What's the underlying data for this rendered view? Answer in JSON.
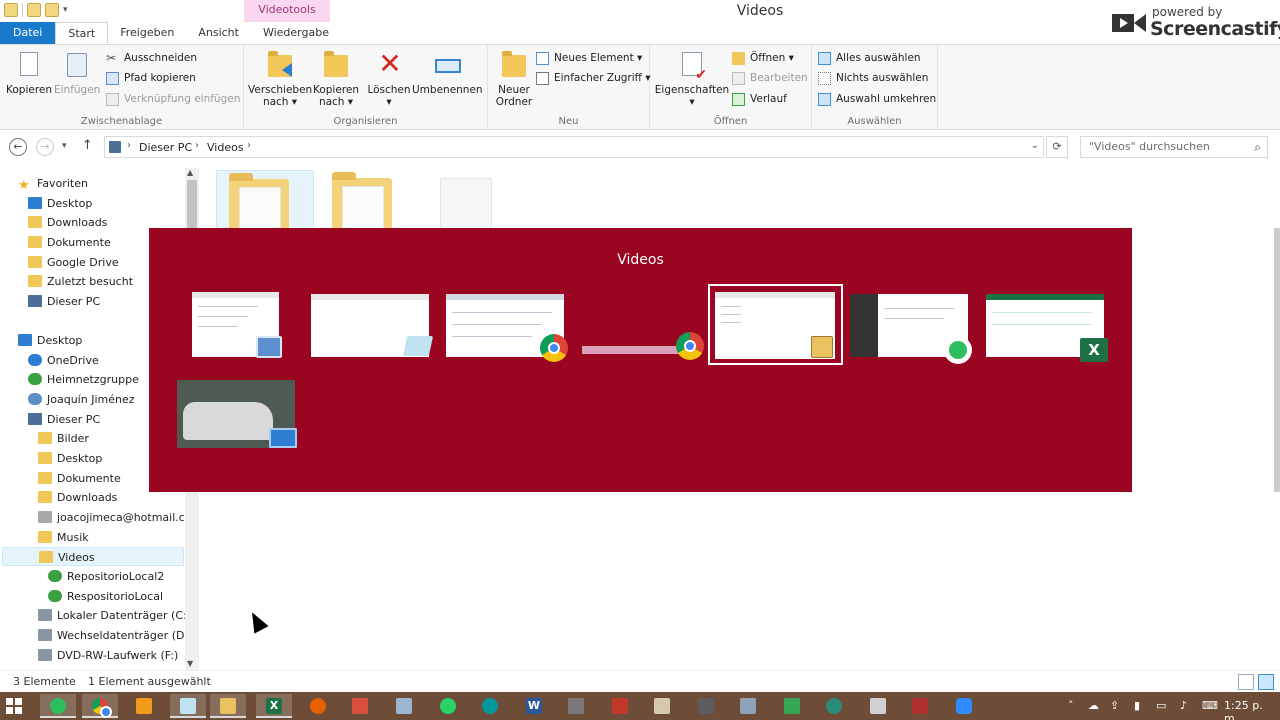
{
  "titlebar": {
    "title": "Videos",
    "context_tab": "Videotools"
  },
  "watermark": {
    "small": "powered by",
    "big": "Screencastify"
  },
  "tabs": [
    {
      "label": "Datei"
    },
    {
      "label": "Start"
    },
    {
      "label": "Freigeben"
    },
    {
      "label": "Ansicht"
    },
    {
      "label": "Wiedergabe"
    }
  ],
  "ribbon": {
    "groups": {
      "clipboard": "Zwischenablage",
      "organize": "Organisieren",
      "new": "Neu",
      "open": "Öffnen",
      "select": "Auswählen"
    },
    "copy": "Kopieren",
    "paste": "Einfügen",
    "cut": "Ausschneiden",
    "copy_path": "Pfad kopieren",
    "paste_shortcut": "Verknüpfung einfügen",
    "move_to_1": "Verschieben",
    "move_to_2": "nach ▾",
    "copy_to_1": "Kopieren",
    "copy_to_2": "nach ▾",
    "delete": "Löschen",
    "delete_arrow": "▾",
    "rename": "Umbenennen",
    "new_folder_1": "Neuer",
    "new_folder_2": "Ordner",
    "new_item": "Neues Element ▾",
    "easy_access": "Einfacher Zugriff ▾",
    "properties": "Eigenschaften",
    "properties_arrow": "▾",
    "open": "Öffnen ▾",
    "edit": "Bearbeiten",
    "history": "Verlauf",
    "select_all": "Alles auswählen",
    "select_none": "Nichts auswählen",
    "invert_selection": "Auswahl umkehren"
  },
  "address": {
    "crumbs": [
      "Dieser PC",
      "Videos"
    ],
    "search_placeholder": "\"Videos\" durchsuchen"
  },
  "nav": {
    "items": [
      {
        "label": "Favoriten"
      },
      {
        "label": "Desktop"
      },
      {
        "label": "Downloads"
      },
      {
        "label": "Dokumente"
      },
      {
        "label": "Google Drive"
      },
      {
        "label": "Zuletzt besucht"
      },
      {
        "label": "Dieser PC"
      },
      {
        "label": "Desktop"
      },
      {
        "label": "OneDrive"
      },
      {
        "label": "Heimnetzgruppe"
      },
      {
        "label": "Joaquín Jiménez"
      },
      {
        "label": "Dieser PC"
      },
      {
        "label": "Bilder"
      },
      {
        "label": "Desktop"
      },
      {
        "label": "Dokumente"
      },
      {
        "label": "Downloads"
      },
      {
        "label": "joacojimeca@hotmail.com"
      },
      {
        "label": "Musik"
      },
      {
        "label": "Videos"
      },
      {
        "label": "RepositorioLocal2"
      },
      {
        "label": "RespositorioLocal"
      },
      {
        "label": "Lokaler Datenträger (C:)"
      },
      {
        "label": "Wechseldatenträger (D:)"
      },
      {
        "label": "DVD-RW-Laufwerk (F:)"
      }
    ]
  },
  "alttab": {
    "title": "Videos"
  },
  "status": {
    "count": "3 Elemente",
    "selected": "1 Element ausgewählt"
  },
  "tray": {
    "clock": "1:25 p. m."
  }
}
